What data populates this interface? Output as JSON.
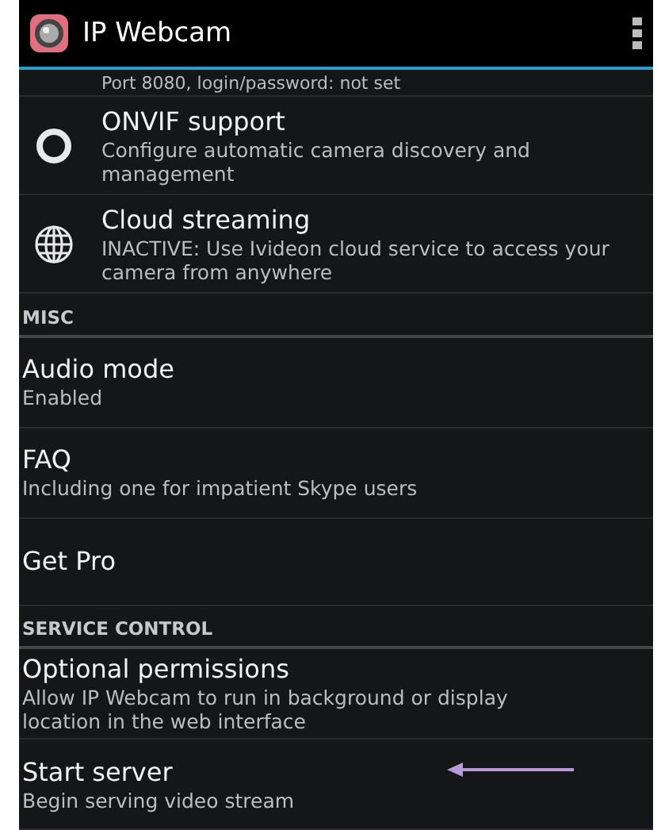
{
  "app_bar": {
    "title": "IP Webcam"
  },
  "items": [
    {
      "kind": "partial",
      "summary": "Port 8080, login/password: not set"
    },
    {
      "kind": "ring",
      "title": "ONVIF support",
      "summary": "Configure automatic camera discovery and management"
    },
    {
      "kind": "globe",
      "title": "Cloud streaming",
      "summary": "INACTIVE: Use Ivideon cloud service to access your camera from anywhere"
    },
    {
      "kind": "header",
      "title": "MISC"
    },
    {
      "kind": "setting",
      "title": "Audio mode",
      "summary": "Enabled"
    },
    {
      "kind": "setting",
      "title": "FAQ",
      "summary": "Including one for impatient Skype users"
    },
    {
      "kind": "setting",
      "title": "Get Pro"
    },
    {
      "kind": "header",
      "title": "SERVICE CONTROL"
    },
    {
      "kind": "setting",
      "title": "Optional permissions",
      "summary": "Allow IP Webcam to run in background or display location in the web interface"
    },
    {
      "kind": "setting",
      "title": "Start server",
      "summary": "Begin serving video stream",
      "arrow": true
    }
  ]
}
